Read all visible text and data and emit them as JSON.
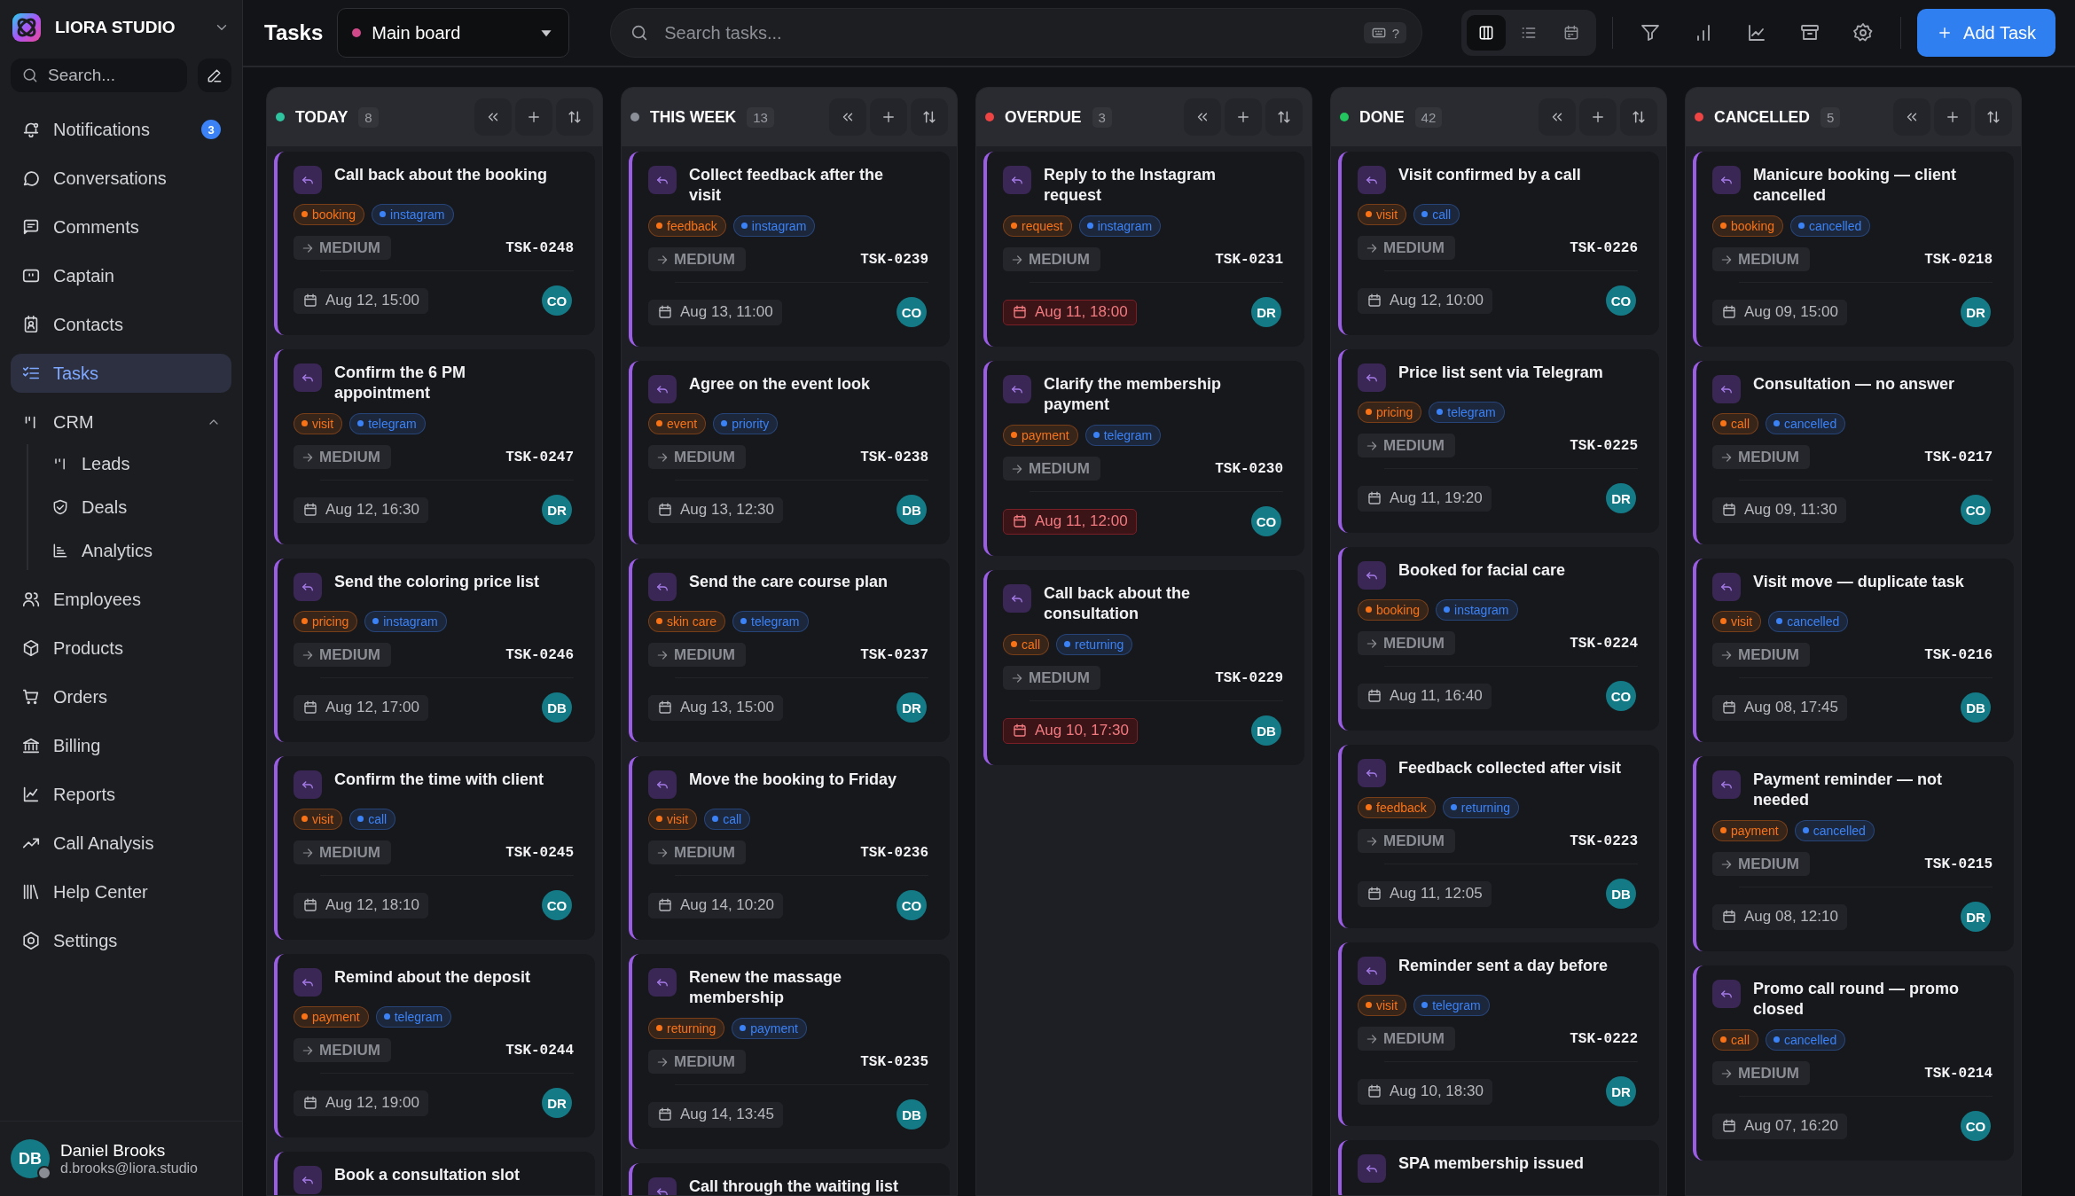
{
  "sidebar": {
    "brand": "LIORA STUDIO",
    "search": {
      "placeholder": "Search..."
    },
    "items": [
      {
        "label": "Notifications",
        "badge": "3",
        "selected": false
      },
      {
        "label": "Conversations",
        "selected": false
      },
      {
        "label": "Comments",
        "selected": false
      },
      {
        "label": "Captain",
        "selected": false
      },
      {
        "label": "Contacts",
        "selected": false
      },
      {
        "label": "Tasks",
        "selected": true
      },
      {
        "label": "CRM",
        "selected": false,
        "expanded": true,
        "children": [
          {
            "label": "Leads",
            "selected": false
          },
          {
            "label": "Deals",
            "selected": false
          },
          {
            "label": "Analytics",
            "selected": false
          }
        ]
      },
      {
        "label": "Employees",
        "selected": false
      },
      {
        "label": "Products",
        "selected": false
      },
      {
        "label": "Orders",
        "selected": false
      },
      {
        "label": "Billing",
        "selected": false
      },
      {
        "label": "Reports",
        "selected": false
      },
      {
        "label": "Call Analysis",
        "selected": false
      },
      {
        "label": "Help Center",
        "selected": false
      },
      {
        "label": "Settings",
        "selected": false
      }
    ],
    "user": {
      "initials": "DB",
      "name": "Daniel Brooks",
      "email": "d.brooks@liora.studio"
    }
  },
  "header": {
    "title": "Tasks",
    "board_select": "Main board",
    "search": {
      "placeholder": "Search tasks...",
      "shortcut": "?"
    },
    "views": [
      {
        "selected": true
      },
      {
        "selected": false
      },
      {
        "selected": false
      }
    ],
    "add_button": "Add Task"
  },
  "columns": [
    {
      "title": "TODAY",
      "count": "8",
      "color": "#2ec4a0",
      "cards": [
        {
          "title": "Call back about the booking",
          "tags": [
            {
              "label": "booking",
              "color": "#f97316"
            },
            {
              "label": "instagram",
              "color": "#3b82f6"
            }
          ],
          "priority": "MEDIUM",
          "id": "TSK-0248",
          "due": "Aug 12, 15:00",
          "overdue": false,
          "assignee": "CO"
        },
        {
          "title": "Confirm the 6 PM appointment",
          "tags": [
            {
              "label": "visit",
              "color": "#f97316"
            },
            {
              "label": "telegram",
              "color": "#3b82f6"
            }
          ],
          "priority": "MEDIUM",
          "id": "TSK-0247",
          "due": "Aug 12, 16:30",
          "overdue": false,
          "assignee": "DR"
        },
        {
          "title": "Send the coloring price list",
          "tags": [
            {
              "label": "pricing",
              "color": "#f97316"
            },
            {
              "label": "instagram",
              "color": "#3b82f6"
            }
          ],
          "priority": "MEDIUM",
          "id": "TSK-0246",
          "due": "Aug 12, 17:00",
          "overdue": false,
          "assignee": "DB"
        },
        {
          "title": "Confirm the time with client",
          "tags": [
            {
              "label": "visit",
              "color": "#f97316"
            },
            {
              "label": "call",
              "color": "#3b82f6"
            }
          ],
          "priority": "MEDIUM",
          "id": "TSK-0245",
          "due": "Aug 12, 18:10",
          "overdue": false,
          "assignee": "CO"
        },
        {
          "title": "Remind about the deposit",
          "tags": [
            {
              "label": "payment",
              "color": "#f97316"
            },
            {
              "label": "telegram",
              "color": "#3b82f6"
            }
          ],
          "priority": "MEDIUM",
          "id": "TSK-0244",
          "due": "Aug 12, 19:00",
          "overdue": false,
          "assignee": "DR"
        },
        {
          "title": "Book a consultation slot"
        }
      ]
    },
    {
      "title": "THIS WEEK",
      "count": "13",
      "color": "#8a8f98",
      "cards": [
        {
          "title": "Collect feedback after the visit",
          "tags": [
            {
              "label": "feedback",
              "color": "#f97316"
            },
            {
              "label": "instagram",
              "color": "#3b82f6"
            }
          ],
          "priority": "MEDIUM",
          "id": "TSK-0239",
          "due": "Aug 13, 11:00",
          "overdue": false,
          "assignee": "CO"
        },
        {
          "title": "Agree on the event look",
          "tags": [
            {
              "label": "event",
              "color": "#f97316"
            },
            {
              "label": "priority",
              "color": "#3b82f6"
            }
          ],
          "priority": "MEDIUM",
          "id": "TSK-0238",
          "due": "Aug 13, 12:30",
          "overdue": false,
          "assignee": "DB"
        },
        {
          "title": "Send the care course plan",
          "tags": [
            {
              "label": "skin care",
              "color": "#f97316"
            },
            {
              "label": "telegram",
              "color": "#3b82f6"
            }
          ],
          "priority": "MEDIUM",
          "id": "TSK-0237",
          "due": "Aug 13, 15:00",
          "overdue": false,
          "assignee": "DR"
        },
        {
          "title": "Move the booking to Friday",
          "tags": [
            {
              "label": "visit",
              "color": "#f97316"
            },
            {
              "label": "call",
              "color": "#3b82f6"
            }
          ],
          "priority": "MEDIUM",
          "id": "TSK-0236",
          "due": "Aug 14, 10:20",
          "overdue": false,
          "assignee": "CO"
        },
        {
          "title": "Renew the massage membership",
          "tags": [
            {
              "label": "returning",
              "color": "#f97316"
            },
            {
              "label": "payment",
              "color": "#3b82f6"
            }
          ],
          "priority": "MEDIUM",
          "id": "TSK-0235",
          "due": "Aug 14, 13:45",
          "overdue": false,
          "assignee": "DB"
        },
        {
          "title": "Call through the waiting list"
        }
      ]
    },
    {
      "title": "OVERDUE",
      "count": "3",
      "color": "#ef4444",
      "cards": [
        {
          "title": "Reply to the Instagram request",
          "tags": [
            {
              "label": "request",
              "color": "#f97316"
            },
            {
              "label": "instagram",
              "color": "#3b82f6"
            }
          ],
          "priority": "MEDIUM",
          "id": "TSK-0231",
          "due": "Aug 11, 18:00",
          "overdue": true,
          "assignee": "DR"
        },
        {
          "title": "Clarify the membership payment",
          "tags": [
            {
              "label": "payment",
              "color": "#f97316"
            },
            {
              "label": "telegram",
              "color": "#3b82f6"
            }
          ],
          "priority": "MEDIUM",
          "id": "TSK-0230",
          "due": "Aug 11, 12:00",
          "overdue": true,
          "assignee": "CO"
        },
        {
          "title": "Call back about the consultation",
          "tags": [
            {
              "label": "call",
              "color": "#f97316"
            },
            {
              "label": "returning",
              "color": "#3b82f6"
            }
          ],
          "priority": "MEDIUM",
          "id": "TSK-0229",
          "due": "Aug 10, 17:30",
          "overdue": true,
          "assignee": "DB"
        }
      ]
    },
    {
      "title": "DONE",
      "count": "42",
      "color": "#22c55e",
      "cards": [
        {
          "title": "Visit confirmed by a call",
          "tags": [
            {
              "label": "visit",
              "color": "#f97316"
            },
            {
              "label": "call",
              "color": "#3b82f6"
            }
          ],
          "priority": "MEDIUM",
          "id": "TSK-0226",
          "due": "Aug 12, 10:00",
          "overdue": false,
          "assignee": "CO"
        },
        {
          "title": "Price list sent via Telegram",
          "tags": [
            {
              "label": "pricing",
              "color": "#f97316"
            },
            {
              "label": "telegram",
              "color": "#3b82f6"
            }
          ],
          "priority": "MEDIUM",
          "id": "TSK-0225",
          "due": "Aug 11, 19:20",
          "overdue": false,
          "assignee": "DR"
        },
        {
          "title": "Booked for facial care",
          "tags": [
            {
              "label": "booking",
              "color": "#f97316"
            },
            {
              "label": "instagram",
              "color": "#3b82f6"
            }
          ],
          "priority": "MEDIUM",
          "id": "TSK-0224",
          "due": "Aug 11, 16:40",
          "overdue": false,
          "assignee": "CO"
        },
        {
          "title": "Feedback collected after visit",
          "tags": [
            {
              "label": "feedback",
              "color": "#f97316"
            },
            {
              "label": "returning",
              "color": "#3b82f6"
            }
          ],
          "priority": "MEDIUM",
          "id": "TSK-0223",
          "due": "Aug 11, 12:05",
          "overdue": false,
          "assignee": "DB"
        },
        {
          "title": "Reminder sent a day before",
          "tags": [
            {
              "label": "visit",
              "color": "#f97316"
            },
            {
              "label": "telegram",
              "color": "#3b82f6"
            }
          ],
          "priority": "MEDIUM",
          "id": "TSK-0222",
          "due": "Aug 10, 18:30",
          "overdue": false,
          "assignee": "DR"
        },
        {
          "title": "SPA membership issued"
        }
      ]
    },
    {
      "title": "CANCELLED",
      "count": "5",
      "color": "#ef4444",
      "cards": [
        {
          "title": "Manicure booking — client cancelled",
          "tags": [
            {
              "label": "booking",
              "color": "#f97316"
            },
            {
              "label": "cancelled",
              "color": "#3b82f6"
            }
          ],
          "priority": "MEDIUM",
          "id": "TSK-0218",
          "due": "Aug 09, 15:00",
          "overdue": false,
          "assignee": "DR"
        },
        {
          "title": "Consultation — no answer",
          "tags": [
            {
              "label": "call",
              "color": "#f97316"
            },
            {
              "label": "cancelled",
              "color": "#3b82f6"
            }
          ],
          "priority": "MEDIUM",
          "id": "TSK-0217",
          "due": "Aug 09, 11:30",
          "overdue": false,
          "assignee": "CO"
        },
        {
          "title": "Visit move — duplicate task",
          "tags": [
            {
              "label": "visit",
              "color": "#f97316"
            },
            {
              "label": "cancelled",
              "color": "#3b82f6"
            }
          ],
          "priority": "MEDIUM",
          "id": "TSK-0216",
          "due": "Aug 08, 17:45",
          "overdue": false,
          "assignee": "DB"
        },
        {
          "title": "Payment reminder — not needed",
          "tags": [
            {
              "label": "payment",
              "color": "#f97316"
            },
            {
              "label": "cancelled",
              "color": "#3b82f6"
            }
          ],
          "priority": "MEDIUM",
          "id": "TSK-0215",
          "due": "Aug 08, 12:10",
          "overdue": false,
          "assignee": "DR"
        },
        {
          "title": "Promo call round — promo closed",
          "tags": [
            {
              "label": "call",
              "color": "#f97316"
            },
            {
              "label": "cancelled",
              "color": "#3b82f6"
            }
          ],
          "priority": "MEDIUM",
          "id": "TSK-0214",
          "due": "Aug 07, 16:20",
          "overdue": false,
          "assignee": "CO"
        }
      ]
    }
  ]
}
